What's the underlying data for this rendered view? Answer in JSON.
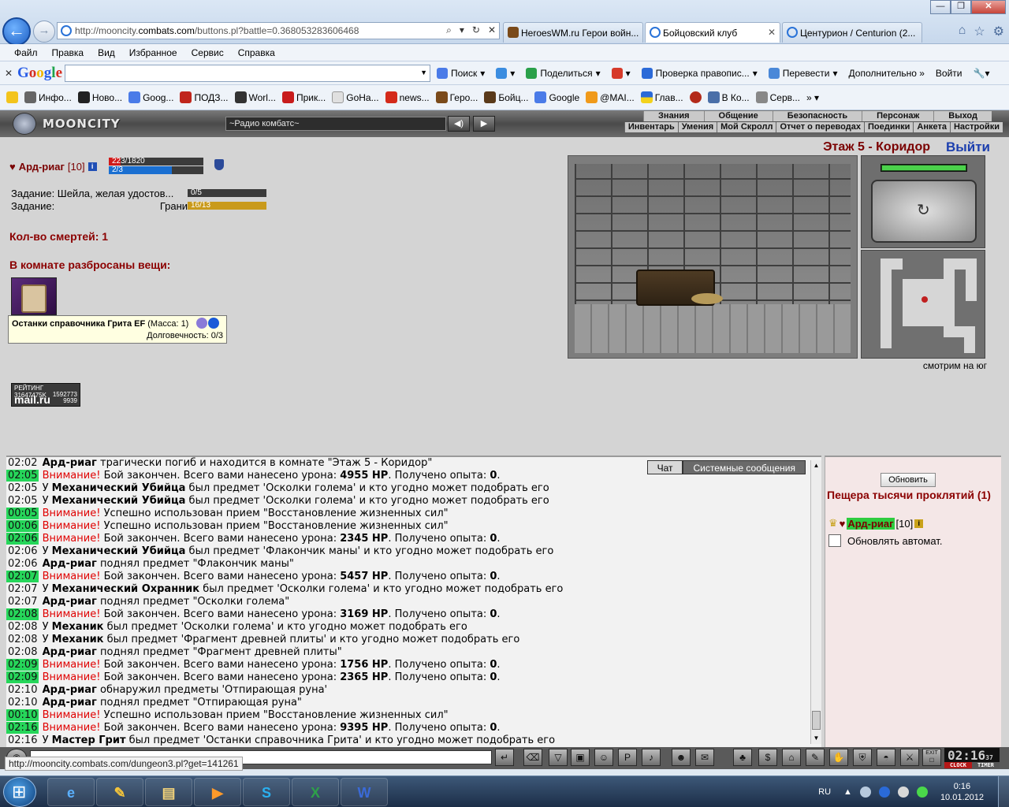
{
  "browser": {
    "url_prefix": "http://mooncity.",
    "url_domain": "combats.com",
    "url_rest": "/buttons.pl?battle=0.368053283606468",
    "tabs": [
      {
        "label": "HeroesWM.ru Герои войн...",
        "active": false
      },
      {
        "label": "Бойцовский клуб",
        "active": true
      },
      {
        "label": "Центурион / Centurion (2...",
        "active": false
      }
    ],
    "menu": [
      "Файл",
      "Правка",
      "Вид",
      "Избранное",
      "Сервис",
      "Справка"
    ]
  },
  "google_bar": {
    "items": [
      "Поиск",
      "Поделиться",
      "Проверка правопис...",
      "Перевести",
      "Дополнительно »",
      "Войти"
    ]
  },
  "favorites": [
    "Инфо...",
    "Ново...",
    "Goog...",
    "ПОДЗ...",
    "Worl...",
    "Прик...",
    "GoHa...",
    "news...",
    "Геро...",
    "Бойц...",
    "Google",
    "@MAI...",
    "Глав...",
    "В Ко...",
    "Серв..."
  ],
  "game": {
    "logo": "MOONCITY",
    "radio": "~Радио комбатс~",
    "nav_top": [
      "Знания",
      "Общение",
      "Безопасность",
      "Персонаж",
      "Выход"
    ],
    "nav_bottom": [
      "Инвентарь",
      "Умения",
      "Мой Скролл",
      "Отчет о переводах",
      "Поединки",
      "Анкета",
      "Настройки"
    ],
    "character": {
      "name": "Ард-риаг",
      "level": "[10]",
      "hp_text": "223/1820",
      "hp_fraction": 0.1225,
      "mana_text": "2/3",
      "mana_fraction": 0.667
    },
    "tasks": [
      {
        "label": "Задание: Шейла, желая удостов...",
        "extra": "",
        "progress": "0/5",
        "fraction": 0
      },
      {
        "label": "Задание:",
        "extra": "Гранит",
        "progress": "16/13",
        "fraction": 1
      }
    ],
    "deaths": "Кол-во смертей: 1",
    "items_title": "В комнате разбросаны вещи:",
    "item": {
      "name": "Останки справочника Грита EF",
      "mass": "(Масса: 1)",
      "durability": "Долговечность: 0/3"
    },
    "rating": {
      "label": "РЕЙТИНГ",
      "n1": "31647475K",
      "n2": "1592773",
      "n3": "9939",
      "logo": "mail.ru"
    },
    "location": "Этаж 5 - Коридор",
    "exit": "Выйти",
    "facing": "смотрим на юг"
  },
  "chat": {
    "tabs": [
      "Чат",
      "Системные сообщения"
    ],
    "messages": [
      {
        "ts": "02:02",
        "hl": false,
        "warn": "",
        "bold": "Ард-риаг",
        "pre": "",
        "text": " трагически погиб и находится в комнате \"Этаж 5 - Коридор\"",
        "bold2": "",
        "text2": "",
        "bold3": "",
        "text3": ""
      },
      {
        "ts": "02:05",
        "hl": true,
        "warn": "Внимание!",
        "bold": "",
        "pre": "",
        "text": " Бой закончен. Всего вами нанесено урона: ",
        "bold2": "4955 HP",
        "text2": ". Получено опыта: ",
        "bold3": "0",
        "text3": "."
      },
      {
        "ts": "02:05",
        "hl": false,
        "warn": "",
        "pre": "У ",
        "bold": "Механический Убийца",
        "text": " был предмет 'Осколки голема' и кто угодно может подобрать его",
        "bold2": "",
        "text2": "",
        "bold3": "",
        "text3": ""
      },
      {
        "ts": "02:05",
        "hl": false,
        "warn": "",
        "pre": "У ",
        "bold": "Механический Убийца",
        "text": " был предмет 'Осколки голема' и кто угодно может подобрать его",
        "bold2": "",
        "text2": "",
        "bold3": "",
        "text3": ""
      },
      {
        "ts": "00:05",
        "hl": true,
        "warn": "Внимание!",
        "pre": "",
        "bold": "",
        "text": " Успешно использован прием \"Восстановление жизненных сил\"",
        "bold2": "",
        "text2": "",
        "bold3": "",
        "text3": ""
      },
      {
        "ts": "00:06",
        "hl": true,
        "warn": "Внимание!",
        "pre": "",
        "bold": "",
        "text": " Успешно использован прием \"Восстановление жизненных сил\"",
        "bold2": "",
        "text2": "",
        "bold3": "",
        "text3": ""
      },
      {
        "ts": "02:06",
        "hl": true,
        "warn": "Внимание!",
        "pre": "",
        "bold": "",
        "text": " Бой закончен. Всего вами нанесено урона: ",
        "bold2": "2345 HP",
        "text2": ". Получено опыта: ",
        "bold3": "0",
        "text3": "."
      },
      {
        "ts": "02:06",
        "hl": false,
        "warn": "",
        "pre": "У ",
        "bold": "Механический Убийца",
        "text": " был предмет 'Флакончик маны' и кто угодно может подобрать его",
        "bold2": "",
        "text2": "",
        "bold3": "",
        "text3": ""
      },
      {
        "ts": "02:06",
        "hl": false,
        "warn": "",
        "pre": "",
        "bold": "Ард-риаг",
        "text": " поднял предмет \"Флакончик маны\"",
        "bold2": "",
        "text2": "",
        "bold3": "",
        "text3": ""
      },
      {
        "ts": "02:07",
        "hl": true,
        "warn": "Внимание!",
        "pre": "",
        "bold": "",
        "text": " Бой закончен. Всего вами нанесено урона: ",
        "bold2": "5457 HP",
        "text2": ". Получено опыта: ",
        "bold3": "0",
        "text3": "."
      },
      {
        "ts": "02:07",
        "hl": false,
        "warn": "",
        "pre": "У ",
        "bold": "Механический Охранник",
        "text": " был предмет 'Осколки голема' и кто угодно может подобрать его",
        "bold2": "",
        "text2": "",
        "bold3": "",
        "text3": ""
      },
      {
        "ts": "02:07",
        "hl": false,
        "warn": "",
        "pre": "",
        "bold": "Ард-риаг",
        "text": " поднял предмет \"Осколки голема\"",
        "bold2": "",
        "text2": "",
        "bold3": "",
        "text3": ""
      },
      {
        "ts": "02:08",
        "hl": true,
        "warn": "Внимание!",
        "pre": "",
        "bold": "",
        "text": " Бой закончен. Всего вами нанесено урона: ",
        "bold2": "3169 HP",
        "text2": ". Получено опыта: ",
        "bold3": "0",
        "text3": "."
      },
      {
        "ts": "02:08",
        "hl": false,
        "warn": "",
        "pre": "У ",
        "bold": "Механик",
        "text": " был предмет 'Осколки голема' и кто угодно может подобрать его",
        "bold2": "",
        "text2": "",
        "bold3": "",
        "text3": ""
      },
      {
        "ts": "02:08",
        "hl": false,
        "warn": "",
        "pre": "У ",
        "bold": "Механик",
        "text": " был предмет 'Фрагмент древней плиты' и кто угодно может подобрать его",
        "bold2": "",
        "text2": "",
        "bold3": "",
        "text3": ""
      },
      {
        "ts": "02:08",
        "hl": false,
        "warn": "",
        "pre": "",
        "bold": "Ард-риаг",
        "text": " поднял предмет \"Фрагмент древней плиты\"",
        "bold2": "",
        "text2": "",
        "bold3": "",
        "text3": ""
      },
      {
        "ts": "02:09",
        "hl": true,
        "warn": "Внимание!",
        "pre": "",
        "bold": "",
        "text": " Бой закончен. Всего вами нанесено урона: ",
        "bold2": "1756 HP",
        "text2": ". Получено опыта: ",
        "bold3": "0",
        "text3": "."
      },
      {
        "ts": "02:09",
        "hl": true,
        "warn": "Внимание!",
        "pre": "",
        "bold": "",
        "text": " Бой закончен. Всего вами нанесено урона: ",
        "bold2": "2365 HP",
        "text2": ". Получено опыта: ",
        "bold3": "0",
        "text3": "."
      },
      {
        "ts": "02:10",
        "hl": false,
        "warn": "",
        "pre": "",
        "bold": "Ард-риаг",
        "text": " обнаружил предметы 'Отпирающая руна'",
        "bold2": "",
        "text2": "",
        "bold3": "",
        "text3": ""
      },
      {
        "ts": "02:10",
        "hl": false,
        "warn": "",
        "pre": "",
        "bold": "Ард-риаг",
        "text": " поднял предмет \"Отпирающая руна\"",
        "bold2": "",
        "text2": "",
        "bold3": "",
        "text3": ""
      },
      {
        "ts": "00:10",
        "hl": true,
        "warn": "Внимание!",
        "pre": "",
        "bold": "",
        "text": " Успешно использован прием \"Восстановление жизненных сил\"",
        "bold2": "",
        "text2": "",
        "bold3": "",
        "text3": ""
      },
      {
        "ts": "02:16",
        "hl": true,
        "warn": "Внимание!",
        "pre": "",
        "bold": "",
        "text": " Бой закончен. Всего вами нанесено урона: ",
        "bold2": "9395 HP",
        "text2": ". Получено опыта: ",
        "bold3": "0",
        "text3": "."
      },
      {
        "ts": "02:16",
        "hl": false,
        "warn": "",
        "pre": "У ",
        "bold": "Мастер Грит",
        "text": " был предмет 'Останки справочника Грита' и кто угодно может подобрать его",
        "bold2": "",
        "text2": "",
        "bold3": "",
        "text3": ""
      }
    ]
  },
  "side": {
    "refresh": "Обновить",
    "room": "Пещера тысячи проклятий (1)",
    "user_name": "Ард-риаг",
    "user_level": "[10]",
    "auto_refresh": "Обновлять автомат."
  },
  "clock": {
    "time": "02:16",
    "sec": "37",
    "label1": "CLOCK",
    "label2": "TIMER",
    "exit": "EXIT"
  },
  "status_url": "http://mooncity.combats.com/dungeon3.pl?get=141261",
  "taskbar": {
    "lang": "RU",
    "time": "0:16",
    "date": "10.01.2012"
  },
  "colors": {
    "hp": "#d11a1a",
    "mana": "#1a6fd1",
    "task": "#c99a1b",
    "highlight": "#26d65a"
  }
}
